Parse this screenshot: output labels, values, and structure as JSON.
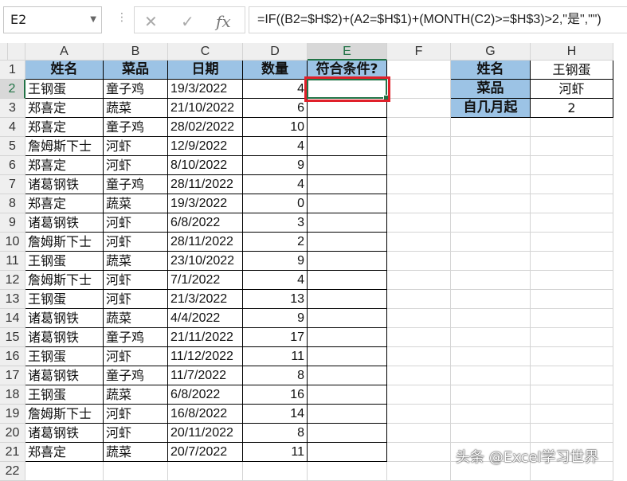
{
  "formula_bar": {
    "name_box": "E2",
    "cancel_glyph": "✕",
    "enter_glyph": "✓",
    "fx_glyph": "fx",
    "formula": "=IF((B2=$H$2)+(A2=$H$1)+(MONTH(C2)>=$H$3)>2,\"是\",\"\")"
  },
  "columns": [
    "A",
    "B",
    "C",
    "D",
    "E",
    "F",
    "G",
    "H"
  ],
  "rows": [
    "1",
    "2",
    "3",
    "4",
    "5",
    "6",
    "7",
    "8",
    "9",
    "10",
    "11",
    "12",
    "13",
    "14",
    "15",
    "16",
    "17",
    "18",
    "19",
    "20",
    "21",
    "22"
  ],
  "headers": [
    "姓名",
    "菜品",
    "日期",
    "数量",
    "符合条件?"
  ],
  "data_rows": [
    [
      "王钢蛋",
      "童子鸡",
      "19/3/2022",
      "4",
      ""
    ],
    [
      "郑喜定",
      "蔬菜",
      "21/10/2022",
      "6",
      ""
    ],
    [
      "郑喜定",
      "童子鸡",
      "28/02/2022",
      "10",
      ""
    ],
    [
      "詹姆斯下士",
      "河虾",
      "12/9/2022",
      "4",
      ""
    ],
    [
      "郑喜定",
      "河虾",
      "8/10/2022",
      "9",
      ""
    ],
    [
      "诸葛钢铁",
      "童子鸡",
      "28/11/2022",
      "4",
      ""
    ],
    [
      "郑喜定",
      "蔬菜",
      "19/3/2022",
      "0",
      ""
    ],
    [
      "诸葛钢铁",
      "河虾",
      "6/8/2022",
      "3",
      ""
    ],
    [
      "詹姆斯下士",
      "河虾",
      "28/11/2022",
      "2",
      ""
    ],
    [
      "王钢蛋",
      "蔬菜",
      "23/10/2022",
      "9",
      ""
    ],
    [
      "詹姆斯下士",
      "河虾",
      "7/1/2022",
      "4",
      ""
    ],
    [
      "王钢蛋",
      "河虾",
      "21/3/2022",
      "13",
      ""
    ],
    [
      "诸葛钢铁",
      "蔬菜",
      "4/4/2022",
      "9",
      ""
    ],
    [
      "诸葛钢铁",
      "童子鸡",
      "21/11/2022",
      "17",
      ""
    ],
    [
      "王钢蛋",
      "河虾",
      "11/12/2022",
      "11",
      ""
    ],
    [
      "诸葛钢铁",
      "童子鸡",
      "11/7/2022",
      "8",
      ""
    ],
    [
      "王钢蛋",
      "蔬菜",
      "6/8/2022",
      "16",
      ""
    ],
    [
      "詹姆斯下士",
      "河虾",
      "16/8/2022",
      "14",
      ""
    ],
    [
      "诸葛钢铁",
      "河虾",
      "20/11/2022",
      "8",
      ""
    ],
    [
      "郑喜定",
      "蔬菜",
      "20/7/2022",
      "11",
      ""
    ]
  ],
  "criteria": [
    {
      "label": "姓名",
      "value": "王钢蛋"
    },
    {
      "label": "菜品",
      "value": "河虾"
    },
    {
      "label": "自几月起",
      "value": "2"
    }
  ],
  "selected_cell": "E2",
  "watermark": "头条 @Excel学习世界"
}
